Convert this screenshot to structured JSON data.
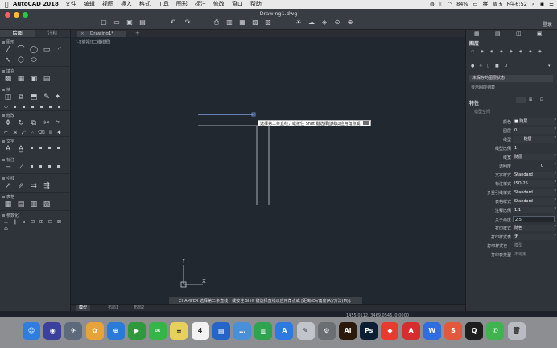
{
  "menubar": {
    "app_name": "AutoCAD 2018",
    "menus": [
      "文件",
      "编辑",
      "视图",
      "插入",
      "格式",
      "工具",
      "图形",
      "标注",
      "修改",
      "窗口",
      "帮助"
    ],
    "battery": "84%",
    "clock": "周五 下午6:52"
  },
  "window": {
    "title": "Drawing1.dwg",
    "login_label": "登录"
  },
  "left_palette": {
    "tabs": [
      "绘图",
      "注释"
    ],
    "sections": [
      "图形",
      "填充",
      "块",
      "修改",
      "文字",
      "标注",
      "引线",
      "表格",
      "参数化"
    ]
  },
  "drawing": {
    "tab_label": "Drawing1*",
    "view_label": "[-][俯视][二维线框]",
    "prompt_tooltip": "选择第二条直线，或按住 Shift 键选择直线以应用角点或",
    "command_line": "CHAMFER 选择第二条直线，或按住 Shift 键选择直线以应用角点或 [距离(D)/角度(A)/方法(M)]:",
    "command_prefix": "~",
    "coordinates": "1455.0112, 3469.0546, 0.0000",
    "layout_tabs": [
      "模型",
      "布局1",
      "布局2"
    ],
    "ucs_x": "X",
    "ucs_y": "Y"
  },
  "layers_panel": {
    "title": "图层",
    "current_layer": "0",
    "layer_state": "未保存的图层状态",
    "show_list": "显示图层列表"
  },
  "properties_panel": {
    "title": "特性",
    "subtitle": "模型空间",
    "rows": [
      {
        "label": "颜色",
        "value": "■ 随层"
      },
      {
        "label": "图层",
        "value": "0"
      },
      {
        "label": "线型",
        "value": "—— 随层"
      },
      {
        "label": "线型比例",
        "value": "1"
      },
      {
        "label": "线宽",
        "value": "随层"
      },
      {
        "label": "透明度",
        "value": "0"
      },
      {
        "label": "文字样式",
        "value": "Standard"
      },
      {
        "label": "标注样式",
        "value": "ISO-25"
      },
      {
        "label": "多重引线样式",
        "value": "Standard"
      },
      {
        "label": "表格样式",
        "value": "Standard"
      },
      {
        "label": "注释比例",
        "value": "1:1"
      },
      {
        "label": "文字高度",
        "value": "2.5"
      },
      {
        "label": "打印样式",
        "value": "随色"
      },
      {
        "label": "打印样式表",
        "value": "无"
      },
      {
        "label": "打印样式已...",
        "value": "模型"
      },
      {
        "label": "打印表类型",
        "value": "不可用"
      }
    ]
  },
  "dock": {
    "apps": [
      {
        "name": "finder-icon",
        "color": "#2f7de1",
        "glyph": "☺"
      },
      {
        "name": "siri-icon",
        "color": "#3b3f9e",
        "glyph": "◉"
      },
      {
        "name": "launchpad-icon",
        "color": "#5d6a7b",
        "glyph": "✈"
      },
      {
        "name": "photos-icon",
        "color": "#e8a23a",
        "glyph": "✿"
      },
      {
        "name": "safari-icon",
        "color": "#2a7ad8",
        "glyph": "⊕"
      },
      {
        "name": "facetime-icon",
        "color": "#2f9a3d",
        "glyph": "▶"
      },
      {
        "name": "messages-icon",
        "color": "#35b547",
        "glyph": "✉"
      },
      {
        "name": "notes-icon",
        "color": "#e7d15c",
        "glyph": "≡"
      },
      {
        "name": "calendar-icon",
        "color": "#f2f2f2",
        "glyph": "4"
      },
      {
        "name": "keynote-icon",
        "color": "#2565c7",
        "glyph": "▤"
      },
      {
        "name": "chat-icon",
        "color": "#4a90d9",
        "glyph": "…"
      },
      {
        "name": "numbers-icon",
        "color": "#2ea44f",
        "glyph": "▥"
      },
      {
        "name": "appstore-icon",
        "color": "#2d7be0",
        "glyph": "A"
      },
      {
        "name": "preview-icon",
        "color": "#c0c5cc",
        "glyph": "✎"
      },
      {
        "name": "system-preferences-icon",
        "color": "#6b6e73",
        "glyph": "⚙"
      },
      {
        "name": "illustrator-icon",
        "color": "#2b1a0c",
        "glyph": "Ai"
      },
      {
        "name": "photoshop-icon",
        "color": "#0b1e33",
        "glyph": "Ps"
      },
      {
        "name": "sketchup-icon",
        "color": "#e63b2e",
        "glyph": "◆"
      },
      {
        "name": "autocad-icon",
        "color": "#d52e2e",
        "glyph": "A"
      },
      {
        "name": "wps-icon",
        "color": "#2f6de0",
        "glyph": "W"
      },
      {
        "name": "sogou-icon",
        "color": "#e2583c",
        "glyph": "S"
      },
      {
        "name": "qq-icon",
        "color": "#1e1e1e",
        "glyph": "Q"
      },
      {
        "name": "wechat-icon",
        "color": "#3fb34f",
        "glyph": "✆"
      },
      {
        "name": "trash-icon",
        "color": "#b8bcc2",
        "glyph": "🗑"
      }
    ]
  }
}
